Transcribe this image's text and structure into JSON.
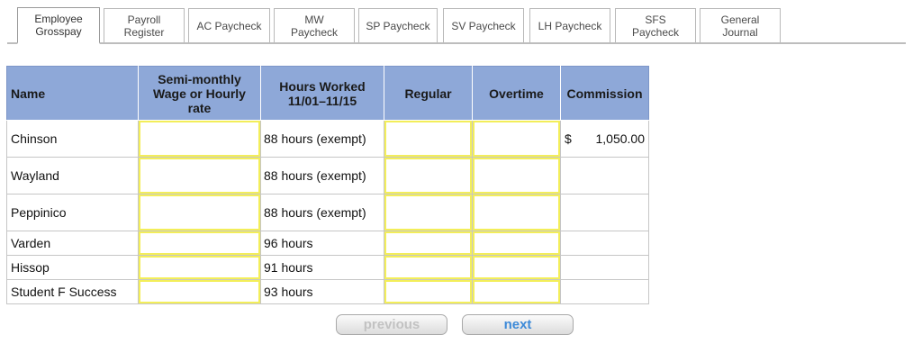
{
  "tabs": [
    {
      "label": "Employee\nGrosspay",
      "active": true
    },
    {
      "label": "Payroll\nRegister",
      "active": false
    },
    {
      "label": "AC Paycheck",
      "active": false
    },
    {
      "label": "MW\nPaycheck",
      "active": false
    },
    {
      "label": "SP Paycheck",
      "active": false
    },
    {
      "label": "SV Paycheck",
      "active": false
    },
    {
      "label": "LH Paycheck",
      "active": false
    },
    {
      "label": "SFS\nPaycheck",
      "active": false
    },
    {
      "label": "General\nJournal",
      "active": false
    }
  ],
  "table": {
    "headers": {
      "name": "Name",
      "rate": "Semi-monthly Wage or Hourly rate",
      "hours": "Hours Worked 11/01–11/15",
      "regular": "Regular",
      "overtime": "Overtime",
      "commission": "Commission"
    },
    "rows": [
      {
        "name": "Chinson",
        "hours": "88 hours (exempt)",
        "commission_symbol": "$",
        "commission": "1,050.00",
        "rate": "",
        "regular": "",
        "overtime": ""
      },
      {
        "name": "Wayland",
        "hours": "88 hours (exempt)",
        "commission_symbol": "",
        "commission": "",
        "rate": "",
        "regular": "",
        "overtime": ""
      },
      {
        "name": "Peppinico",
        "hours": "88 hours (exempt)",
        "commission_symbol": "",
        "commission": "",
        "rate": "",
        "regular": "",
        "overtime": ""
      },
      {
        "name": "Varden",
        "hours": "96 hours",
        "commission_symbol": "",
        "commission": "",
        "rate": "",
        "regular": "",
        "overtime": ""
      },
      {
        "name": "Hissop",
        "hours": "91 hours",
        "commission_symbol": "",
        "commission": "",
        "rate": "",
        "regular": "",
        "overtime": ""
      },
      {
        "name": "Student F Success",
        "hours": "93 hours",
        "commission_symbol": "",
        "commission": "",
        "rate": "",
        "regular": "",
        "overtime": ""
      }
    ]
  },
  "nav": {
    "previous_label": "previous",
    "next_label": "next"
  },
  "colors": {
    "header_bg": "#8ea8d8",
    "input_border": "#f3ee5a",
    "next_text": "#3d8ad8",
    "previous_text": "#c2c2c2"
  }
}
